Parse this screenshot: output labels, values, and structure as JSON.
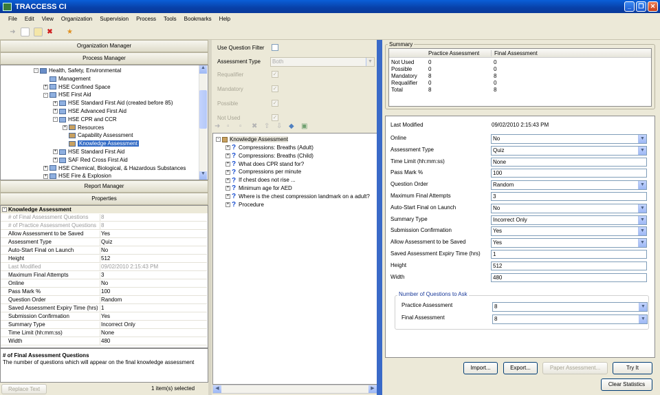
{
  "window": {
    "title": "TRACCESS CI"
  },
  "menu": [
    "File",
    "Edit",
    "View",
    "Organization",
    "Supervision",
    "Process",
    "Tools",
    "Bookmarks",
    "Help"
  ],
  "left": {
    "org_manager": "Organization Manager",
    "process_manager": "Process Manager",
    "report_manager": "Report Manager",
    "properties_header": "Properties",
    "tree": [
      {
        "label": "Health, Safety, Environmental",
        "level": 0,
        "toggle": "-"
      },
      {
        "label": "Management",
        "level": 1,
        "toggle": ""
      },
      {
        "label": "HSE  Confined Space",
        "level": 1,
        "toggle": "+"
      },
      {
        "label": "HSE  First Aid",
        "level": 1,
        "toggle": "-"
      },
      {
        "label": "HSE  Standard First Aid (created before 85)",
        "level": 2,
        "toggle": "+"
      },
      {
        "label": "HSE  Advanced First Aid",
        "level": 2,
        "toggle": "+"
      },
      {
        "label": "HSE  CPR and CCR",
        "level": 2,
        "toggle": "-"
      },
      {
        "label": "Resources",
        "level": 3,
        "toggle": "+"
      },
      {
        "label": "Capability Assessment",
        "level": 3,
        "toggle": ""
      },
      {
        "label": "Knowledge Assessment",
        "level": 3,
        "toggle": "",
        "selected": true
      },
      {
        "label": "HSE  Standard First Aid",
        "level": 2,
        "toggle": "+"
      },
      {
        "label": "SAF  Red Cross First Aid",
        "level": 2,
        "toggle": "+"
      },
      {
        "label": "HSE  Chemical, Biological, & Hazardous Substances",
        "level": 1,
        "toggle": "+"
      },
      {
        "label": "HSE  Fire & Explosion",
        "level": 1,
        "toggle": "+"
      }
    ],
    "props_section": "Knowledge Assessment",
    "props": [
      {
        "k": "# of Final Assessment Questions",
        "v": "8",
        "gray": true
      },
      {
        "k": "# of Practice Assessment Questions",
        "v": "8",
        "gray": true
      },
      {
        "k": "Allow Assessment to be Saved",
        "v": "Yes"
      },
      {
        "k": "Assessment Type",
        "v": "Quiz"
      },
      {
        "k": "Auto-Start Final on Launch",
        "v": "No"
      },
      {
        "k": "Height",
        "v": "512"
      },
      {
        "k": "Last Modified",
        "v": "09/02/2010 2:15:43 PM",
        "gray": true
      },
      {
        "k": "Maximum Final Attempts",
        "v": "3"
      },
      {
        "k": "Online",
        "v": "No"
      },
      {
        "k": "Pass Mark %",
        "v": "100"
      },
      {
        "k": "Question Order",
        "v": "Random"
      },
      {
        "k": "Saved Assessment Expiry Time (hrs)",
        "v": "1"
      },
      {
        "k": "Submission Confirmation",
        "v": "Yes"
      },
      {
        "k": "Summary Type",
        "v": "Incorrect Only"
      },
      {
        "k": "Time Limit (hh:mm:ss)",
        "v": "None"
      },
      {
        "k": "Width",
        "v": "480"
      }
    ],
    "desc_title": "# of Final Assessment Questions",
    "desc_text": "The number of questions which will appear on the final knowledge assessment",
    "replace_text": "Replace Text",
    "status": "1 item(s) selected"
  },
  "middle": {
    "use_filter": "Use Question Filter",
    "assessment_type_label": "Assessment Type",
    "assessment_type_value": "Both",
    "filters": [
      "Requalifier",
      "Mandatory",
      "Possible",
      "Not Used"
    ],
    "root": "Knowledge Assessment",
    "questions": [
      "Compressions: Breaths (Adult)",
      "Compressions: Breaths (Child)",
      "What does CPR stand for?",
      "Compressions per minute",
      "If chest does not rise ...",
      "Minimum age for AED",
      "Where is the chest compression landmark on a adult?",
      "Procedure"
    ]
  },
  "right": {
    "summary_title": "Summary",
    "summary_cols": [
      "Practice Assessment",
      "Final Assessment"
    ],
    "summary_rows": [
      {
        "label": "Not Used",
        "p": "0",
        "f": "0"
      },
      {
        "label": "Possible",
        "p": "0",
        "f": "0"
      },
      {
        "label": "Mandatory",
        "p": "8",
        "f": "8"
      },
      {
        "label": "Requalifier",
        "p": "0",
        "f": "0"
      },
      {
        "label": "Total",
        "p": "8",
        "f": "8"
      }
    ],
    "last_modified_label": "Last Modified",
    "last_modified_value": "09/02/2010 2:15:43 PM",
    "fields": [
      {
        "label": "Online",
        "value": "No",
        "type": "select"
      },
      {
        "label": "Assessment Type",
        "value": "Quiz",
        "type": "select"
      },
      {
        "label": "Time Limit (hh:mm:ss)",
        "value": "None",
        "type": "text"
      },
      {
        "label": "Pass Mark %",
        "value": "100",
        "type": "text"
      },
      {
        "label": "Question Order",
        "value": "Random",
        "type": "select"
      },
      {
        "label": "Maximum Final Attempts",
        "value": "3",
        "type": "text"
      },
      {
        "label": "Auto-Start Final on Launch",
        "value": "No",
        "type": "select"
      },
      {
        "label": "Summary Type",
        "value": "Incorrect Only",
        "type": "select"
      },
      {
        "label": "Submission Confirmation",
        "value": "Yes",
        "type": "select"
      },
      {
        "label": "Allow Assessment to be Saved",
        "value": "Yes",
        "type": "select"
      },
      {
        "label": "Saved Assessment Expiry Time (hrs)",
        "value": "1",
        "type": "text"
      },
      {
        "label": "Height",
        "value": "512",
        "type": "text"
      },
      {
        "label": "Width",
        "value": "480",
        "type": "text"
      }
    ],
    "nq_title": "Number of Questions to Ask",
    "nq_practice_label": "Practice Assessment",
    "nq_practice_value": "8",
    "nq_final_label": "Final Assessment",
    "nq_final_value": "8",
    "btn_import": "Import...",
    "btn_export": "Export...",
    "btn_paper": "Paper Assessment...",
    "btn_try": "Try It",
    "btn_clear": "Clear Statistics"
  },
  "colors": {
    "title_blue": "#0a4fc4",
    "selected": "#316ac5",
    "panel_bg": "#ece9d8"
  }
}
